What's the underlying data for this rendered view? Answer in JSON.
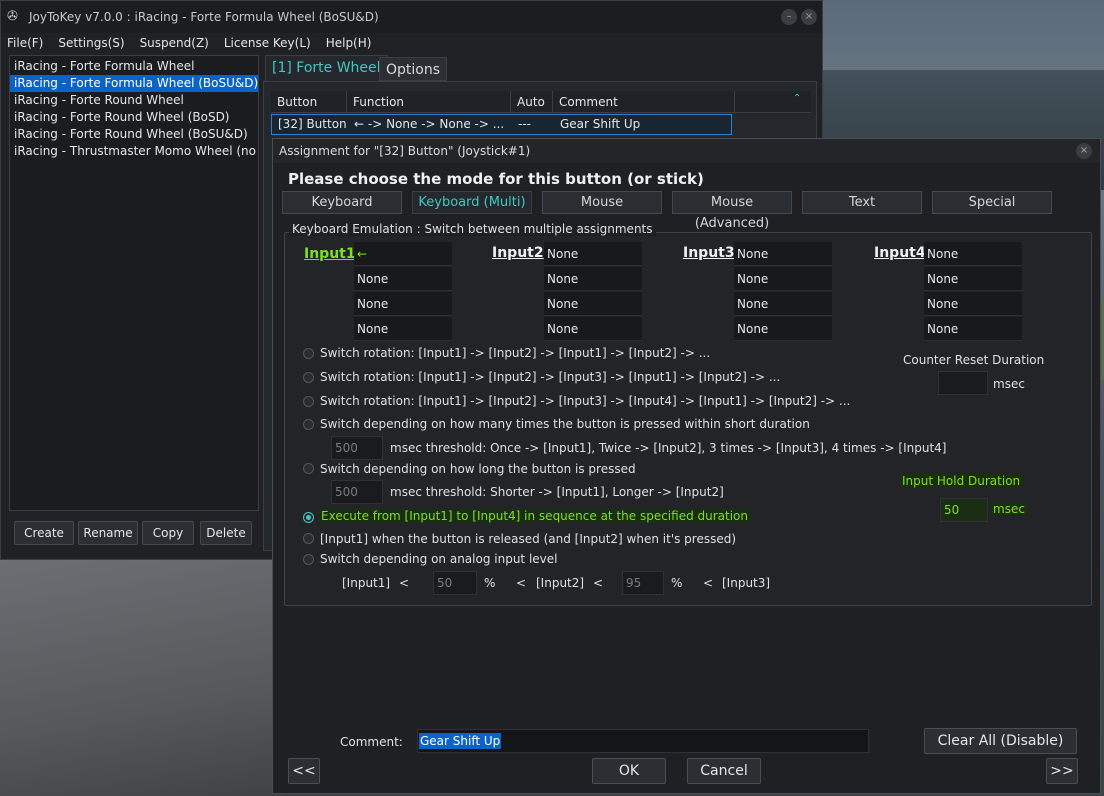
{
  "window": {
    "title": "JoyToKey v7.0.0 : iRacing - Forte Formula Wheel (BoSU&D)",
    "minimize": "–",
    "close": "×"
  },
  "menu": [
    "File(F)",
    "Settings(S)",
    "Suspend(Z)",
    "License Key(L)",
    "Help(H)"
  ],
  "profiles": [
    "iRacing - Forte Formula Wheel",
    "iRacing - Forte Formula Wheel (BoSU&D)",
    "iRacing - Forte Round Wheel",
    "iRacing - Forte Round Wheel (BoSD)",
    "iRacing - Forte Round Wheel (BoSU&D)",
    "iRacing - Thrustmaster Momo Wheel (no"
  ],
  "profile_buttons": {
    "create": "Create",
    "rename": "Rename",
    "copy": "Copy",
    "delete": "Delete"
  },
  "tabs": {
    "active": "[1] Forte Wheel",
    "options": "Options"
  },
  "grid": {
    "headers": [
      "Button",
      "Function",
      "Auto",
      "Comment"
    ],
    "row": {
      "button": "[32] Button",
      "function": "← -> None -> None -> ...",
      "auto": "---",
      "comment": "Gear Shift Up"
    }
  },
  "dialog": {
    "title": "Assignment for \"[32] Button\" (Joystick#1)",
    "close": "×",
    "heading": "Please choose the mode for this button (or stick)",
    "mode_tabs": [
      "Keyboard",
      "Keyboard (Multi)",
      "Mouse",
      "Mouse (Advanced)",
      "Text",
      "Special"
    ],
    "group_title": "Keyboard Emulation : Switch between multiple assignments",
    "inputs": [
      {
        "label": "Input1",
        "slots": [
          "←",
          "None",
          "None",
          "None"
        ]
      },
      {
        "label": "Input2",
        "slots": [
          "None",
          "None",
          "None",
          "None"
        ]
      },
      {
        "label": "Input3",
        "slots": [
          "None",
          "None",
          "None",
          "None"
        ]
      },
      {
        "label": "Input4",
        "slots": [
          "None",
          "None",
          "None",
          "None"
        ]
      }
    ],
    "options": {
      "rot2": "Switch rotation: [Input1] -> [Input2] -> [Input1] -> [Input2] -> ...",
      "rot3": "Switch rotation: [Input1] -> [Input2] -> [Input3] -> [Input1] -> [Input2] -> ...",
      "rot4": "Switch rotation: [Input1] -> [Input2] -> [Input3] -> [Input4] -> [Input1] -> [Input2] -> ...",
      "times": "Switch depending on how many times the button is pressed within short duration",
      "times_value": "500",
      "times_desc": "msec threshold: Once -> [Input1], Twice -> [Input2], 3 times -> [Input3], 4 times -> [Input4]",
      "long": "Switch depending on how long the button is pressed",
      "long_value": "500",
      "long_desc": "msec threshold: Shorter -> [Input1], Longer -> [Input2]",
      "sequence": "Execute from [Input1] to [Input4] in sequence at the specified duration",
      "released": "[Input1] when the button is released (and [Input2] when it's pressed)",
      "analog": "Switch depending on analog input level"
    },
    "counter_reset": {
      "label": "Counter Reset Duration",
      "value": "",
      "unit": "msec"
    },
    "hold": {
      "label": "Input Hold Duration",
      "value": "50",
      "unit": "msec"
    },
    "analog_row": {
      "in1": "[Input1]",
      "lt1": "<",
      "v1": "50",
      "pct1": "%",
      "lt2": "<",
      "in2": "[Input2]",
      "lt3": "<",
      "v2": "95",
      "pct2": "%",
      "lt4": "<",
      "in3": "[Input3]"
    },
    "comment_label": "Comment:",
    "comment_value": "Gear Shift Up",
    "clear_all": "Clear All (Disable)",
    "prev": "<<",
    "next": ">>",
    "ok": "OK",
    "cancel": "Cancel"
  },
  "colors": {
    "accent": "#3ec9c2",
    "highlight": "#7ce022",
    "selection": "#0a64c8"
  }
}
